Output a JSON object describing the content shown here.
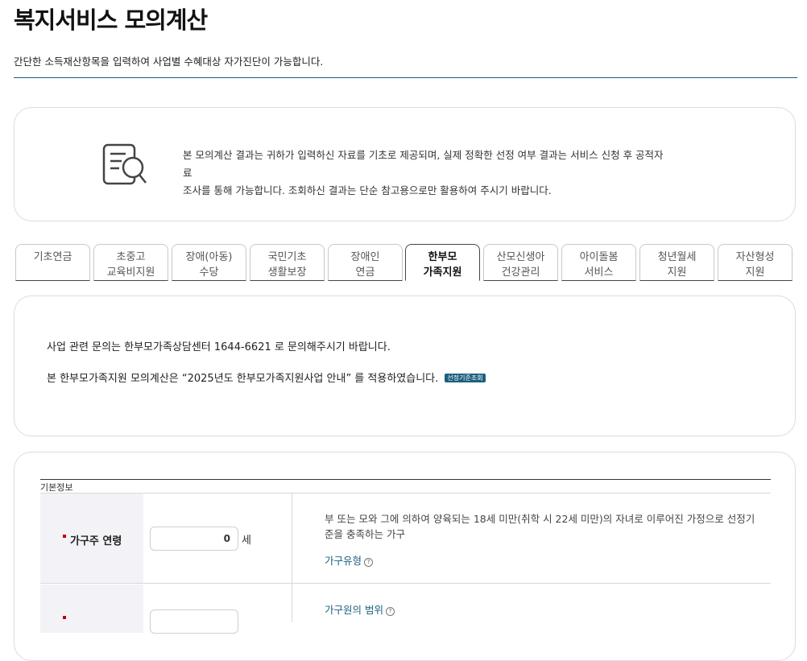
{
  "page": {
    "title": "복지서비스 모의계산",
    "subtitle": "간단한 소득재산항목을 입력하여 사업별 수혜대상 자가진단이 가능합니다."
  },
  "notice": {
    "icon": "document-search-icon",
    "line1": "본 모의계산 결과는 귀하가 입력하신 자료를 기초로 제공되며, 실제 정확한 선정 여부 결과는 서비스 신청 후 공적자료",
    "line2": "조사를 통해 가능합니다. 조회하신 결과는 단순 참고용으로만 활용하여 주시기 바랍니다."
  },
  "tabs": [
    {
      "line1": "기초연금",
      "line2": "",
      "active": false
    },
    {
      "line1": "초중고",
      "line2": "교육비지원",
      "active": false
    },
    {
      "line1": "장애(아동)",
      "line2": "수당",
      "active": false
    },
    {
      "line1": "국민기초",
      "line2": "생활보장",
      "active": false
    },
    {
      "line1": "장애인",
      "line2": "연금",
      "active": false
    },
    {
      "line1": "한부모",
      "line2": "가족지원",
      "active": true
    },
    {
      "line1": "산모신생아",
      "line2": "건강관리",
      "active": false
    },
    {
      "line1": "아이돌봄",
      "line2": "서비스",
      "active": false
    },
    {
      "line1": "청년월세",
      "line2": "지원",
      "active": false
    },
    {
      "line1": "자산형성",
      "line2": "지원",
      "active": false
    }
  ],
  "info": {
    "line1": "사업 관련 문의는 한부모가족상담센터 1644-6621 로 문의해주시기 바랍니다.",
    "line2": "본 한부모가족지원 모의계산은 “2025년도 한부모가족지원사업 안내” 를 적용하였습니다.",
    "criteria_button": "선정기준조회"
  },
  "form": {
    "caption": "기본정보",
    "row1": {
      "label": "가구주 연령",
      "value": "0",
      "unit": "세",
      "description": "부 또는 모와 그에 의하여 양육되는 18세 미만(취학 시 22세 미만)의 자녀로 이루어진 가정으로 선정기준을 충족하는 가구",
      "help_link": "가구유형"
    },
    "row2": {
      "help_link": "가구원의 범위"
    }
  },
  "colors": {
    "accent": "#1b5f7f",
    "required": "#c00000",
    "label_bg": "#f3f3f7"
  }
}
